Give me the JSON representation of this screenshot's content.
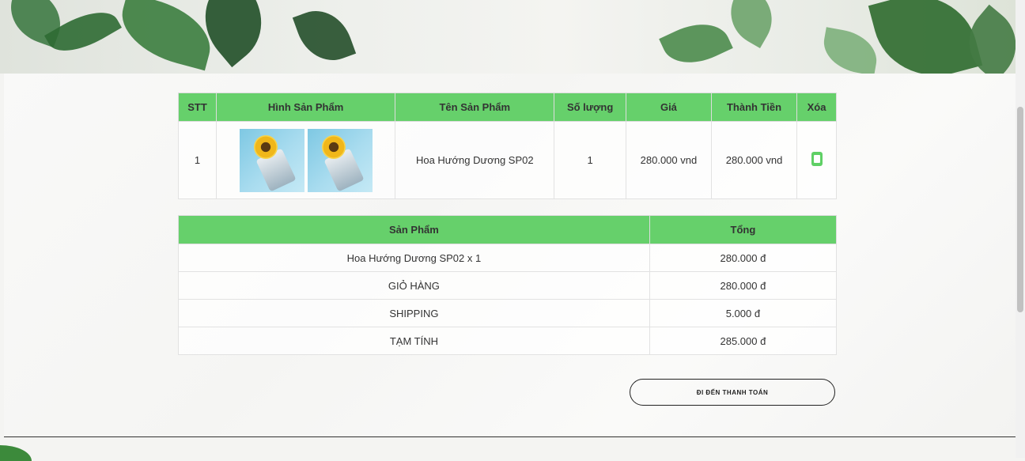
{
  "cart_table": {
    "headers": [
      "STT",
      "Hình Sản Phẩm",
      "Tên Sản Phẩm",
      "Số lượng",
      "Giá",
      "Thành Tiền",
      "Xóa"
    ],
    "rows": [
      {
        "stt": "1",
        "name": "Hoa Hướng Dương SP02",
        "qty": "1",
        "price": "280.000 vnd",
        "total": "280.000 vnd"
      }
    ]
  },
  "summary_table": {
    "headers": [
      "Sản Phẩm",
      "Tổng"
    ],
    "rows": [
      {
        "label": "Hoa Hướng Dương SP02 x 1",
        "value": "280.000 đ"
      },
      {
        "label": "GIỎ HÀNG",
        "value": "280.000 đ"
      },
      {
        "label": "SHIPPING",
        "value": "5.000 đ"
      },
      {
        "label": "TẠM TÍNH",
        "value": "285.000 đ"
      }
    ]
  },
  "checkout_label": "ĐI ĐẾN THANH TOÁN",
  "colors": {
    "header_green": "#66d06b",
    "trash_green": "#5fd065"
  }
}
